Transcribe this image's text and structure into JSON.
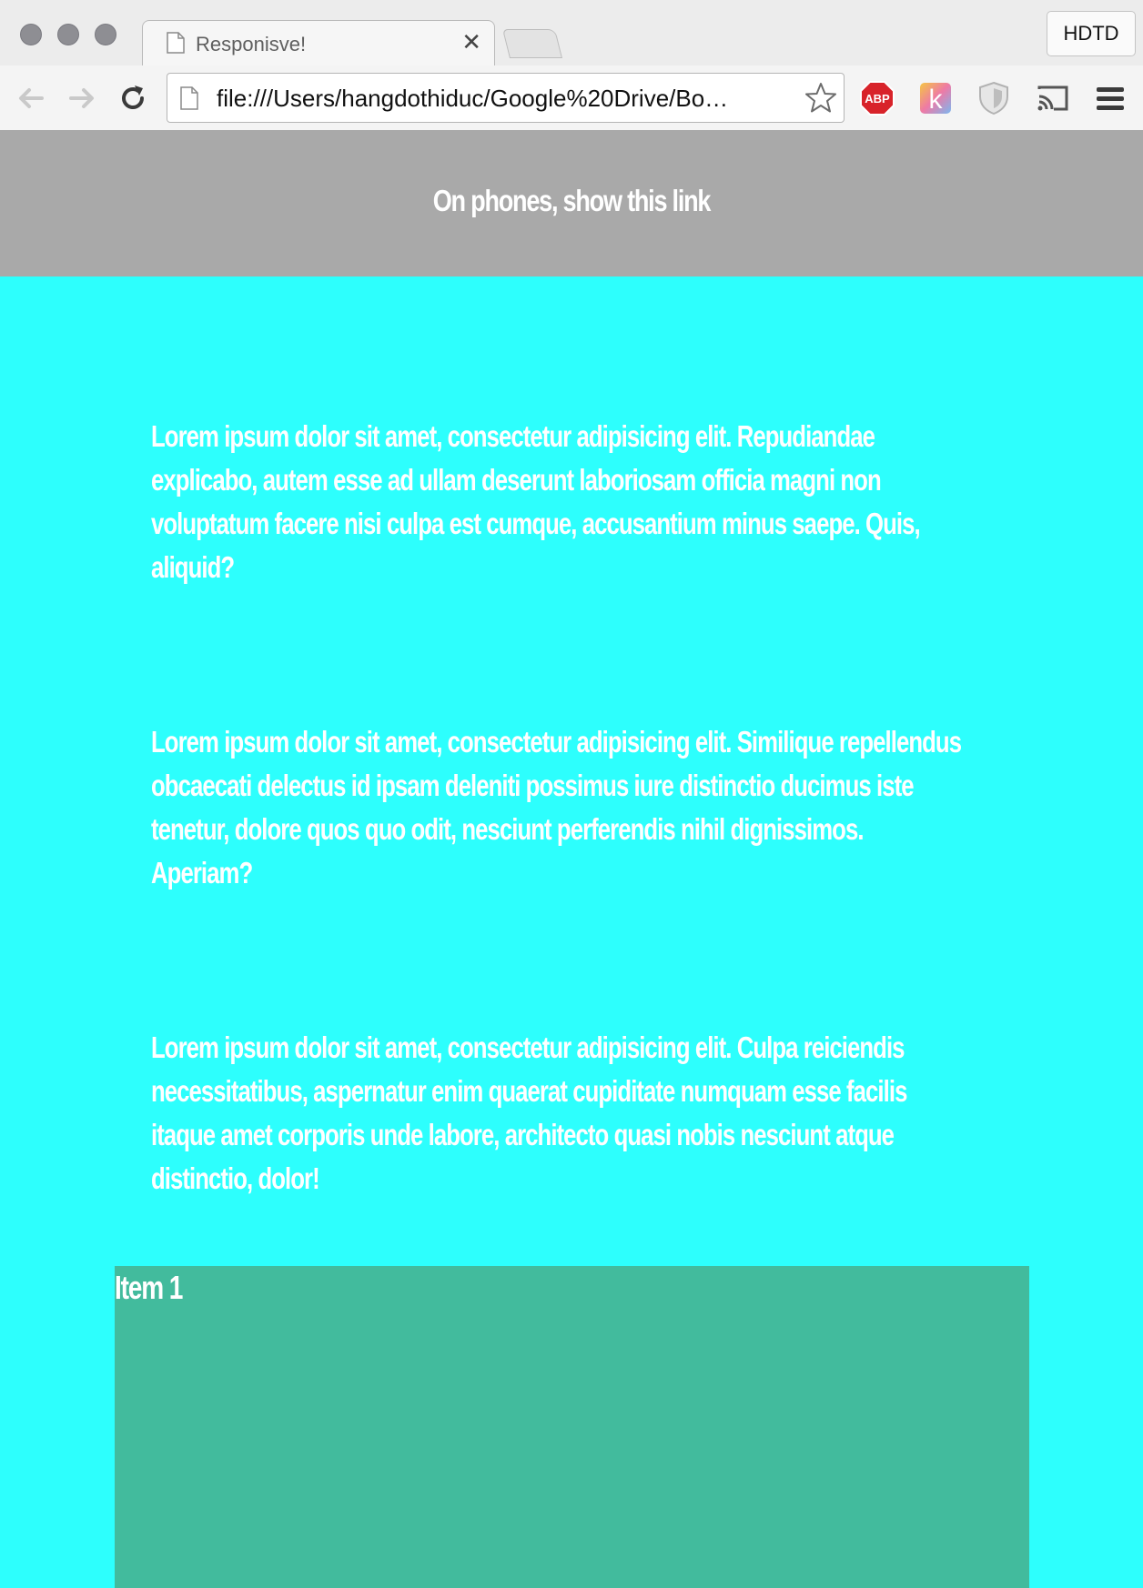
{
  "browser": {
    "tab_title": "Responisve!",
    "profile_label": "HDTD",
    "url": "file:///Users/hangdothiduc/Google%20Drive/Bo…",
    "icons": {
      "window_controls": [
        "close-dot",
        "minimize-dot",
        "zoom-dot"
      ],
      "toolbar": [
        "back-arrow-icon",
        "forward-arrow-icon",
        "reload-icon",
        "page-icon",
        "bookmark-star-icon"
      ],
      "extensions": [
        "adblock-icon",
        "k-extension-icon",
        "shield-icon",
        "cast-icon",
        "menu-icon"
      ]
    },
    "colors": {
      "abp_red": "#d8232a",
      "traffic_gray": "#8e8e93"
    }
  },
  "page": {
    "banner_link": "On phones, show this link",
    "paragraphs": [
      "Lorem ipsum dolor sit amet, consectetur adipisicing elit. Repudiandae explicabo, autem esse ad ullam deserunt laboriosam officia magni non voluptatum facere nisi culpa est cumque, accusantium minus saepe. Quis, aliquid?",
      "Lorem ipsum dolor sit amet, consectetur adipisicing elit. Similique repellendus obcaecati delectus id ipsam deleniti possimus iure distinctio ducimus iste tenetur, dolore quos quo odit, nesciunt perferendis nihil dignissimos. Aperiam?",
      "Lorem ipsum dolor sit amet, consectetur adipisicing elit. Culpa reiciendis necessitatibus, aspernatur enim quaerat cupiditate numquam esse facilis itaque amet corporis unde labore, architecto quasi nobis nesciunt atque distinctio, dolor!"
    ],
    "item_label": "Item 1",
    "colors": {
      "background": "#2dfffd",
      "banner": "#a9a9a9",
      "item_box": "#42bb9d",
      "text": "#ffffff"
    }
  }
}
